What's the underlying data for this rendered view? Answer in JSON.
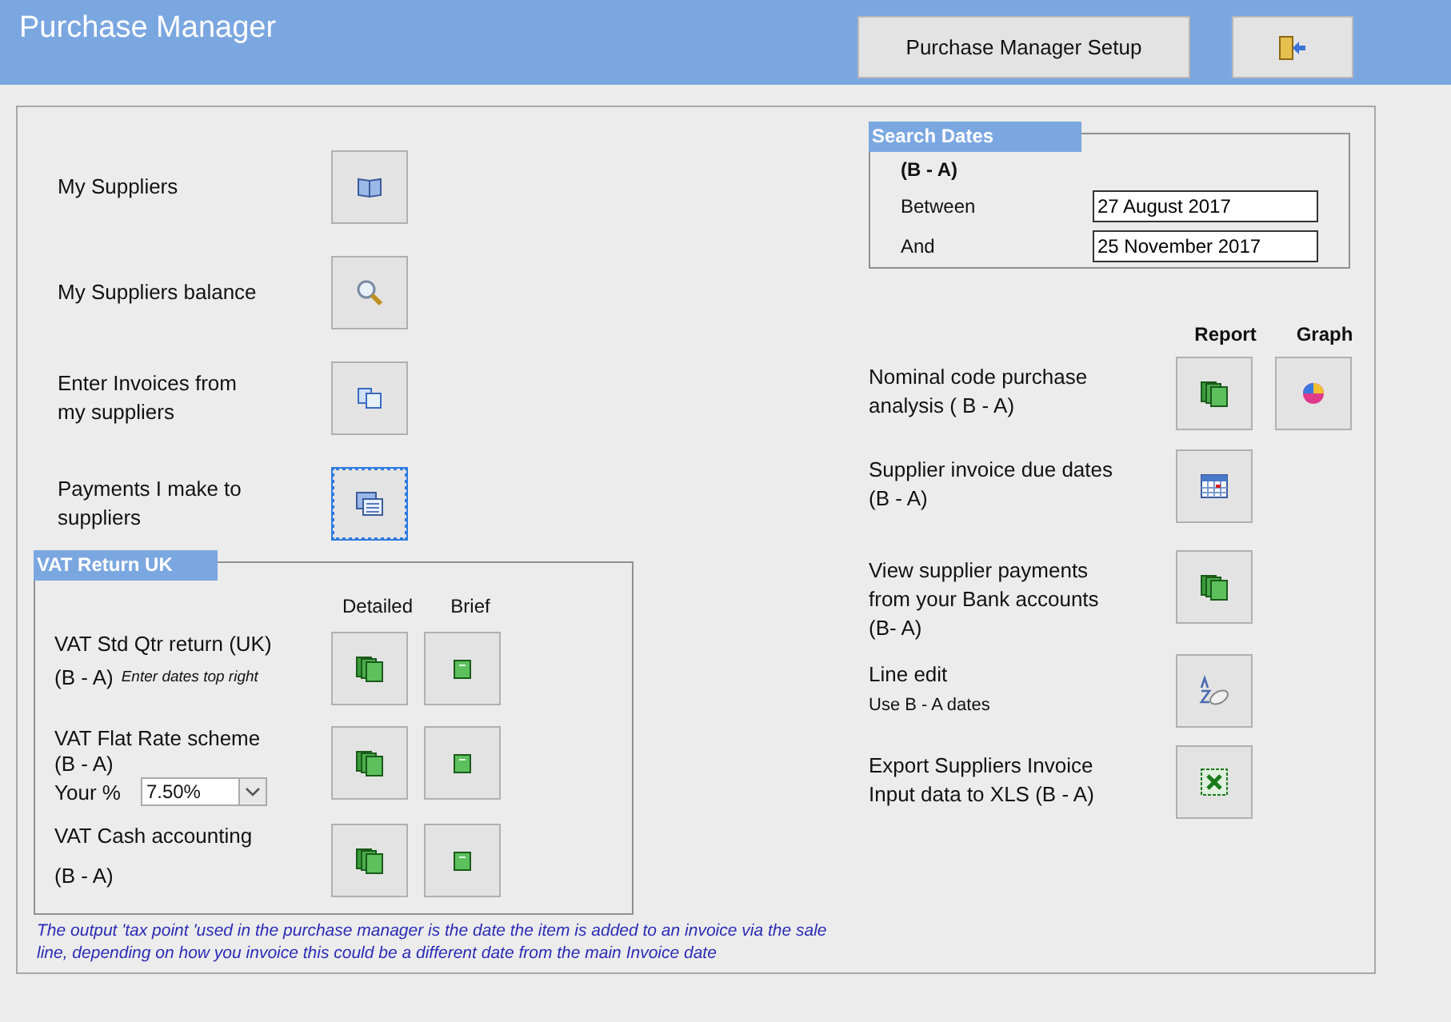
{
  "header": {
    "title": "Purchase Manager",
    "setup_button": "Purchase Manager Setup"
  },
  "menu_items": [
    {
      "lines": [
        "My Suppliers"
      ],
      "focused": false
    },
    {
      "lines": [
        "My Suppliers balance"
      ],
      "focused": false
    },
    {
      "lines": [
        "Enter Invoices from",
        "my suppliers"
      ],
      "focused": false
    },
    {
      "lines": [
        "Payments I make to",
        "suppliers"
      ],
      "focused": true
    }
  ],
  "vat_return": {
    "title": "VAT Return UK",
    "columns": [
      "Detailed",
      "Brief"
    ],
    "rows": [
      {
        "kind": "note",
        "title": "VAT Std Qtr return (UK)",
        "range": "(B - A)",
        "note": "Enter dates top right"
      },
      {
        "kind": "rate",
        "title": "VAT Flat Rate scheme",
        "range": "(B - A)",
        "rate_label": "Your %",
        "rate_value": "7.50%"
      },
      {
        "kind": "plain",
        "title": "VAT Cash accounting",
        "range": "(B - A)"
      }
    ]
  },
  "footnote": "The output 'tax point 'used in the purchase manager is the date the item is added to an invoice via the sale line, depending on how you invoice this could be a different date from the main Invoice date",
  "search_dates": {
    "title": "Search Dates",
    "range": "(B - A)",
    "fields": [
      {
        "label": "Between",
        "value": "27 August 2017"
      },
      {
        "label": "And",
        "value": "25 November 2017"
      }
    ]
  },
  "reports": {
    "columns": [
      "Report",
      "Graph"
    ],
    "rows": [
      {
        "kind": "graph",
        "lines": [
          "Nominal code purchase",
          "analysis  ( B - A)"
        ]
      },
      {
        "kind": "plain",
        "lines": [
          "Supplier invoice due dates",
          "(B -  A)"
        ]
      },
      {
        "kind": "plain",
        "lines": [
          "View supplier payments",
          "from your Bank accounts",
          "(B- A)"
        ]
      },
      {
        "kind": "subtitle",
        "lines": [
          "Line edit"
        ],
        "subtitle": "Use B - A dates"
      },
      {
        "kind": "plain",
        "lines": [
          "Export Suppliers Invoice",
          "Input data to XLS  (B - A)"
        ]
      }
    ]
  }
}
